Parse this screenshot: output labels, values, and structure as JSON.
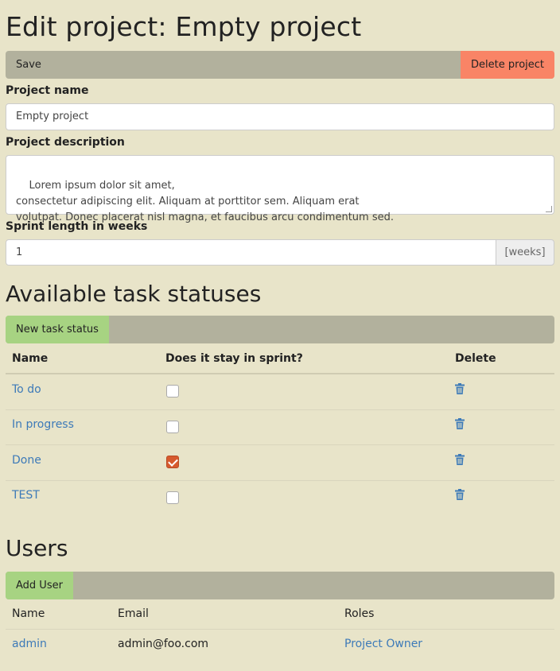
{
  "page_title": "Edit project: Empty project",
  "toolbar": {
    "save_label": "Save",
    "delete_label": "Delete project"
  },
  "form": {
    "name_label": "Project name",
    "name_value": "Empty project",
    "description_label": "Project description",
    "description_value": "Lorem ipsum dolor sit amet,\nconsectetur adipiscing elit. Aliquam at porttitor sem. Aliquam erat\nvolutpat. Donec placerat nisl magna, et faucibus arcu condimentum sed.",
    "sprint_label": "Sprint length in weeks",
    "sprint_value": "1",
    "sprint_unit": "[weeks]"
  },
  "statuses": {
    "heading": "Available task statuses",
    "new_button": "New task status",
    "columns": {
      "name": "Name",
      "stay": "Does it stay in sprint?",
      "delete": "Delete"
    },
    "rows": [
      {
        "name": "To do",
        "stays": false
      },
      {
        "name": "In progress",
        "stays": false
      },
      {
        "name": "Done",
        "stays": true
      },
      {
        "name": "TEST",
        "stays": false
      }
    ]
  },
  "users": {
    "heading": "Users",
    "add_button": "Add User",
    "columns": {
      "name": "Name",
      "email": "Email",
      "roles": "Roles"
    },
    "rows": [
      {
        "name": "admin",
        "email": "admin@foo.com",
        "roles": "Project Owner"
      }
    ]
  },
  "colors": {
    "background": "#e8e4c9",
    "toolbar": "#b2b19d",
    "delete": "#f98466",
    "add": "#a7d382",
    "link": "#3d7ab8",
    "checked": "#d65a2e"
  },
  "icons": {
    "delete": "trash-icon",
    "checkbox_checked": "check-icon"
  }
}
